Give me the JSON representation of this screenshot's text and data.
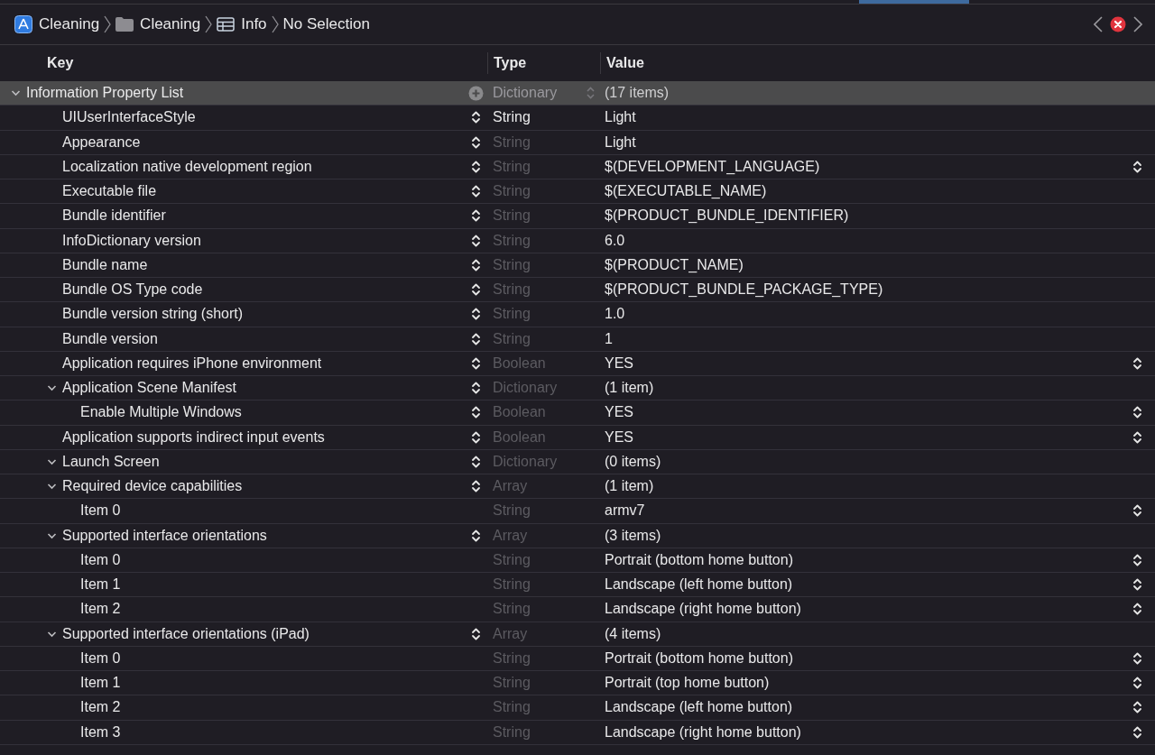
{
  "breadcrumb": [
    {
      "label": "Cleaning",
      "kind": "app"
    },
    {
      "label": "Cleaning",
      "kind": "folder"
    },
    {
      "label": "Info",
      "kind": "table"
    },
    {
      "label": "No Selection",
      "kind": "plain"
    }
  ],
  "issue_badge": {
    "kind": "error"
  },
  "columns": [
    "Key",
    "Type",
    "Value"
  ],
  "root": {
    "key": "Information Property List",
    "type": "Dictionary",
    "value": "(17 items)",
    "selected": true,
    "expanded": true,
    "children": [
      {
        "key": "UIUserInterfaceStyle",
        "type": "String",
        "value": "Light",
        "type_editable": true,
        "key_stepper": true,
        "value_stepper": false,
        "selected": false
      },
      {
        "key": "Appearance",
        "type": "String",
        "value": "Light",
        "type_editable": false,
        "key_stepper": true,
        "value_stepper": false,
        "selected": false
      },
      {
        "key": "Localization native development region",
        "type": "String",
        "value": "$(DEVELOPMENT_LANGUAGE)",
        "type_editable": false,
        "key_stepper": true,
        "value_stepper": true,
        "selected": false
      },
      {
        "key": "Executable file",
        "type": "String",
        "value": "$(EXECUTABLE_NAME)",
        "type_editable": false,
        "key_stepper": true,
        "value_stepper": false,
        "selected": false
      },
      {
        "key": "Bundle identifier",
        "type": "String",
        "value": "$(PRODUCT_BUNDLE_IDENTIFIER)",
        "type_editable": false,
        "key_stepper": true,
        "value_stepper": false,
        "selected": false
      },
      {
        "key": "InfoDictionary version",
        "type": "String",
        "value": "6.0",
        "type_editable": false,
        "key_stepper": true,
        "value_stepper": false,
        "selected": false
      },
      {
        "key": "Bundle name",
        "type": "String",
        "value": "$(PRODUCT_NAME)",
        "type_editable": false,
        "key_stepper": true,
        "value_stepper": false,
        "selected": false
      },
      {
        "key": "Bundle OS Type code",
        "type": "String",
        "value": "$(PRODUCT_BUNDLE_PACKAGE_TYPE)",
        "type_editable": false,
        "key_stepper": true,
        "value_stepper": false,
        "selected": false
      },
      {
        "key": "Bundle version string (short)",
        "type": "String",
        "value": "1.0",
        "type_editable": false,
        "key_stepper": true,
        "value_stepper": false,
        "selected": false
      },
      {
        "key": "Bundle version",
        "type": "String",
        "value": "1",
        "type_editable": false,
        "key_stepper": true,
        "value_stepper": false,
        "selected": false
      },
      {
        "key": "Application requires iPhone environment",
        "type": "Boolean",
        "value": "YES",
        "type_editable": false,
        "key_stepper": true,
        "value_stepper": true,
        "selected": false
      },
      {
        "key": "Application Scene Manifest",
        "type": "Dictionary",
        "value": "(1 item)",
        "type_editable": false,
        "key_stepper": true,
        "value_stepper": false,
        "selected": false,
        "expanded": true,
        "children": [
          {
            "key": "Enable Multiple Windows",
            "type": "Boolean",
            "value": "YES",
            "type_editable": false,
            "key_stepper": true,
            "value_stepper": true,
            "selected": false
          }
        ]
      },
      {
        "key": "Application supports indirect input events",
        "type": "Boolean",
        "value": "YES",
        "type_editable": false,
        "key_stepper": true,
        "value_stepper": true,
        "selected": false
      },
      {
        "key": "Launch Screen",
        "type": "Dictionary",
        "value": "(0 items)",
        "type_editable": false,
        "key_stepper": true,
        "value_stepper": false,
        "selected": false,
        "expanded": true
      },
      {
        "key": "Required device capabilities",
        "type": "Array",
        "value": "(1 item)",
        "type_editable": false,
        "key_stepper": true,
        "value_stepper": false,
        "selected": false,
        "expanded": true,
        "children": [
          {
            "key": "Item 0",
            "type": "String",
            "value": "armv7",
            "type_editable": false,
            "key_stepper": false,
            "value_stepper": true,
            "selected": false
          }
        ]
      },
      {
        "key": "Supported interface orientations",
        "type": "Array",
        "value": "(3 items)",
        "type_editable": false,
        "key_stepper": true,
        "value_stepper": false,
        "selected": false,
        "expanded": true,
        "children": [
          {
            "key": "Item 0",
            "type": "String",
            "value": "Portrait (bottom home button)",
            "type_editable": false,
            "key_stepper": false,
            "value_stepper": true,
            "selected": false
          },
          {
            "key": "Item 1",
            "type": "String",
            "value": "Landscape (left home button)",
            "type_editable": false,
            "key_stepper": false,
            "value_stepper": true,
            "selected": false
          },
          {
            "key": "Item 2",
            "type": "String",
            "value": "Landscape (right home button)",
            "type_editable": false,
            "key_stepper": false,
            "value_stepper": true,
            "selected": false
          }
        ]
      },
      {
        "key": "Supported interface orientations (iPad)",
        "type": "Array",
        "value": "(4 items)",
        "type_editable": false,
        "key_stepper": true,
        "value_stepper": false,
        "selected": false,
        "expanded": true,
        "children": [
          {
            "key": "Item 0",
            "type": "String",
            "value": "Portrait (bottom home button)",
            "type_editable": false,
            "key_stepper": false,
            "value_stepper": true,
            "selected": false
          },
          {
            "key": "Item 1",
            "type": "String",
            "value": "Portrait (top home button)",
            "type_editable": false,
            "key_stepper": false,
            "value_stepper": true,
            "selected": false
          },
          {
            "key": "Item 2",
            "type": "String",
            "value": "Landscape (left home button)",
            "type_editable": false,
            "key_stepper": false,
            "value_stepper": true,
            "selected": false
          },
          {
            "key": "Item 3",
            "type": "String",
            "value": "Landscape (right home button)",
            "type_editable": false,
            "key_stepper": false,
            "value_stepper": true,
            "selected": false
          }
        ]
      }
    ]
  }
}
